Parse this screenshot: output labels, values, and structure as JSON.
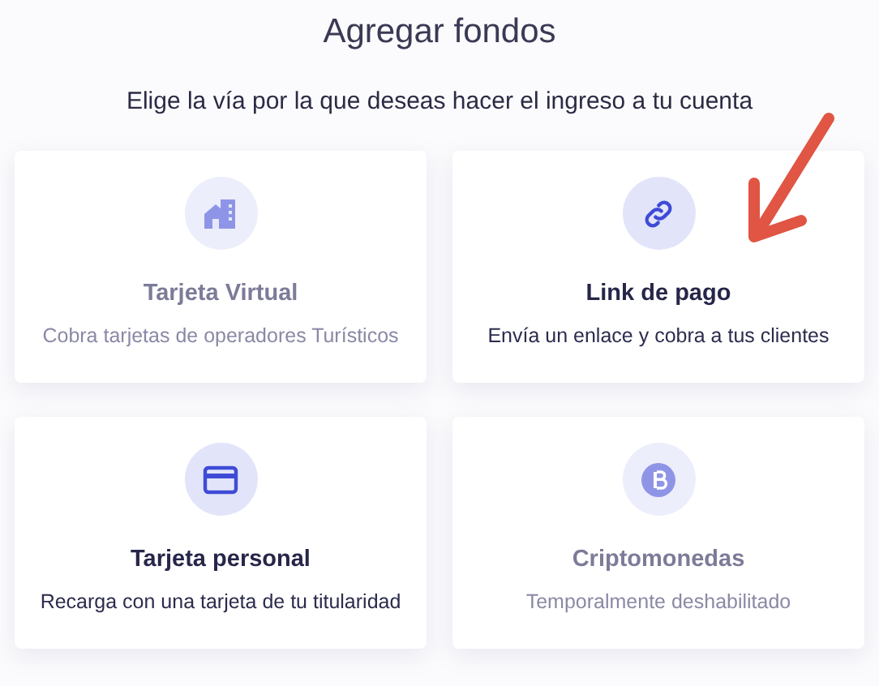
{
  "title": "Agregar fondos",
  "subtitle": "Elige la vía por la que deseas hacer el ingreso a tu cuenta",
  "options": [
    {
      "kind": "buildings",
      "title": "Tarjeta Virtual",
      "description": "Cobra tarjetas de operadores Turísticos",
      "disabled": true
    },
    {
      "kind": "link",
      "title": "Link de pago",
      "description": "Envía un enlace y cobra a tus clientes",
      "disabled": false
    },
    {
      "kind": "card",
      "title": "Tarjeta personal",
      "description": "Recarga con una tarjeta de tu titularidad",
      "disabled": false
    },
    {
      "kind": "coin",
      "title": "Criptomonedas",
      "description": "Temporalmente deshabilitado",
      "disabled": true
    }
  ],
  "annotation": {
    "kind": "arrow"
  }
}
